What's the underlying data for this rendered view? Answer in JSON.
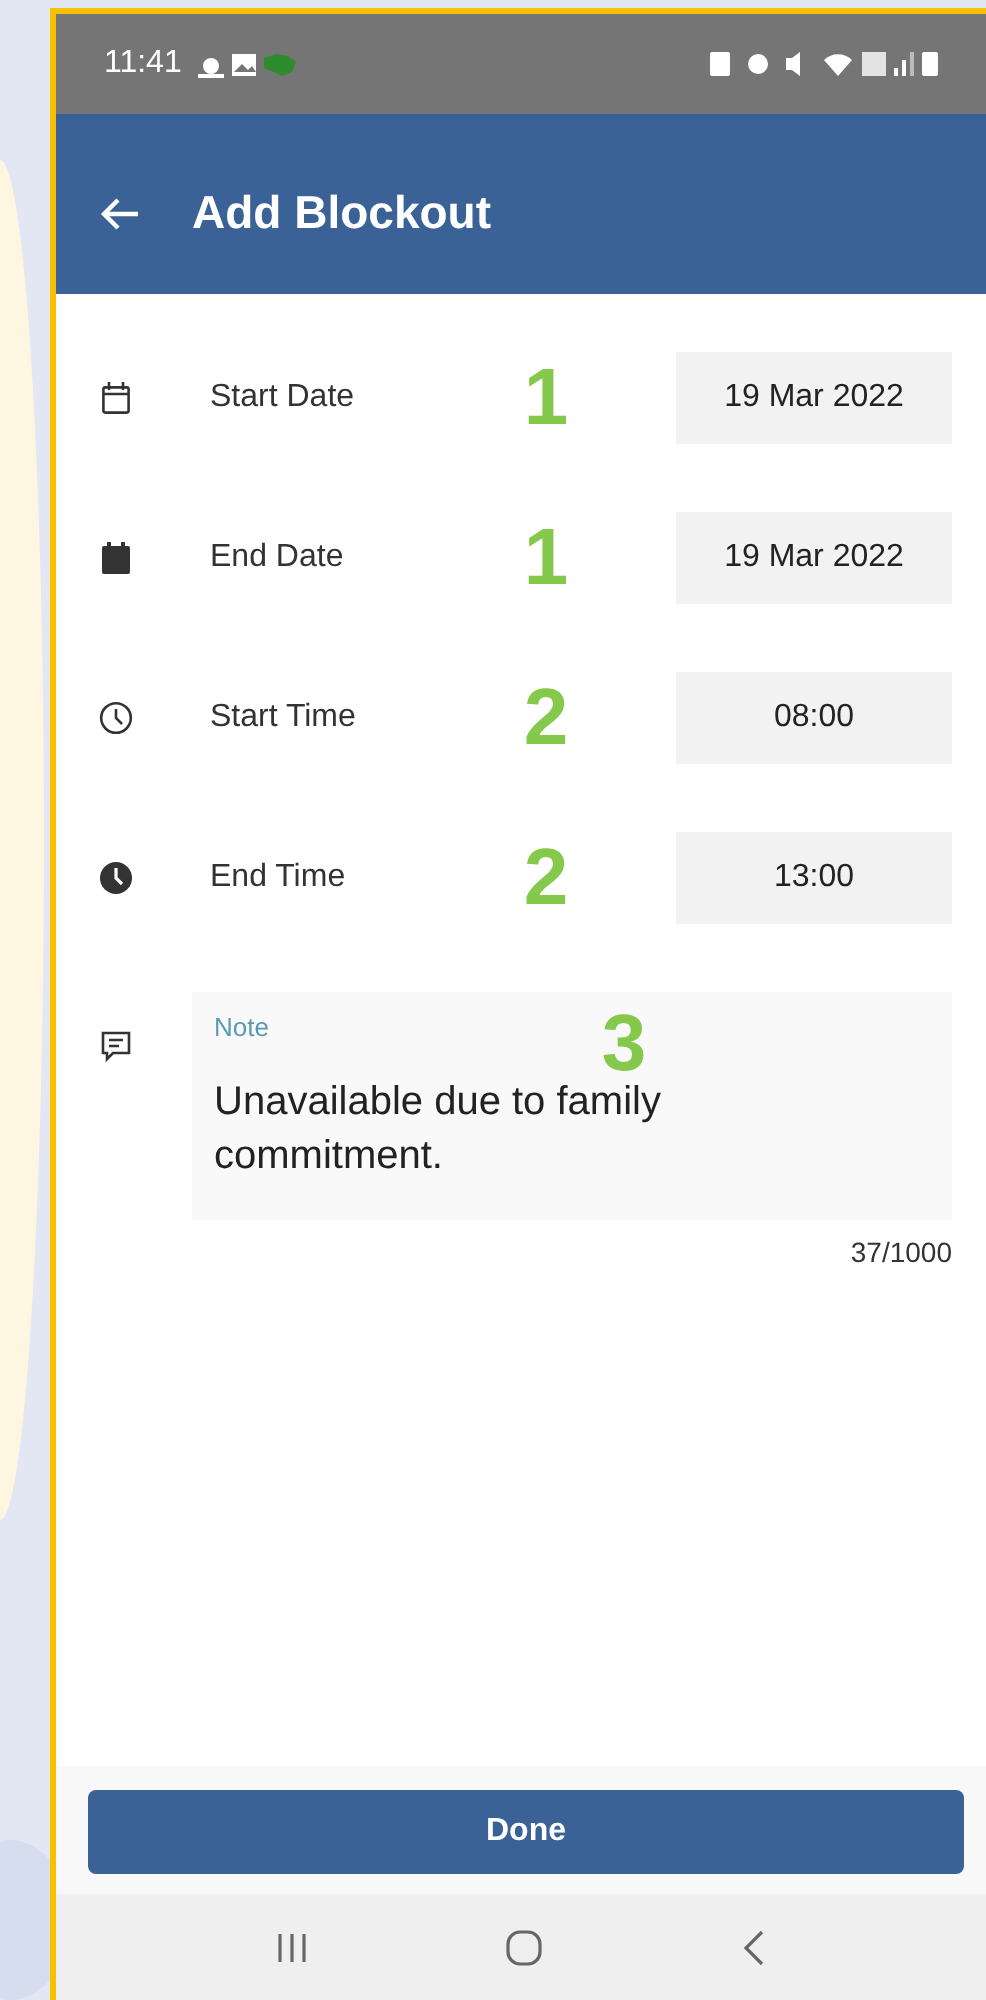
{
  "status_bar": {
    "time": "11:41"
  },
  "app_bar": {
    "title": "Add Blockout"
  },
  "fields": [
    {
      "kind": "date",
      "filled": false,
      "label": "Start Date",
      "value": "19 Mar 2022",
      "annotation": "1"
    },
    {
      "kind": "date",
      "filled": true,
      "label": "End Date",
      "value": "19 Mar 2022",
      "annotation": "1"
    },
    {
      "kind": "time",
      "filled": false,
      "label": "Start Time",
      "value": "08:00",
      "annotation": "2"
    },
    {
      "kind": "time",
      "filled": true,
      "label": "End Time",
      "value": "13:00",
      "annotation": "2"
    }
  ],
  "note": {
    "label": "Note",
    "value": "Unavailable due to family commitment.",
    "counter": "37/1000",
    "annotation": "3"
  },
  "done_button": {
    "label": "Done"
  }
}
